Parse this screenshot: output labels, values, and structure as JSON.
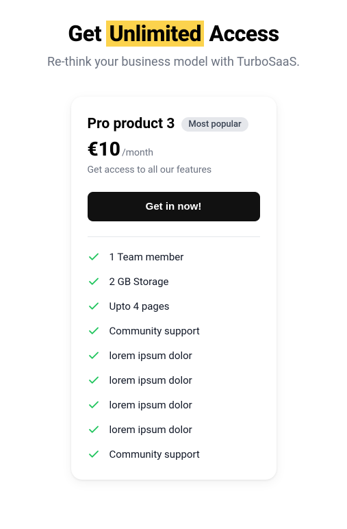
{
  "heading": {
    "pre": "Get ",
    "highlight": "Unlimited",
    "post": " Access"
  },
  "subheading": "Re-think your business model with TurboSaaS.",
  "card": {
    "plan_name": "Pro product 3",
    "badge": "Most popular",
    "price": "€10",
    "period": "/month",
    "description": "Get access to all our features",
    "cta_label": "Get in now!",
    "features": [
      "1 Team member",
      "2 GB Storage",
      "Upto 4 pages",
      "Community support",
      "lorem ipsum dolor",
      "lorem ipsum dolor",
      "lorem ipsum dolor",
      "lorem ipsum dolor",
      "Community support"
    ]
  }
}
